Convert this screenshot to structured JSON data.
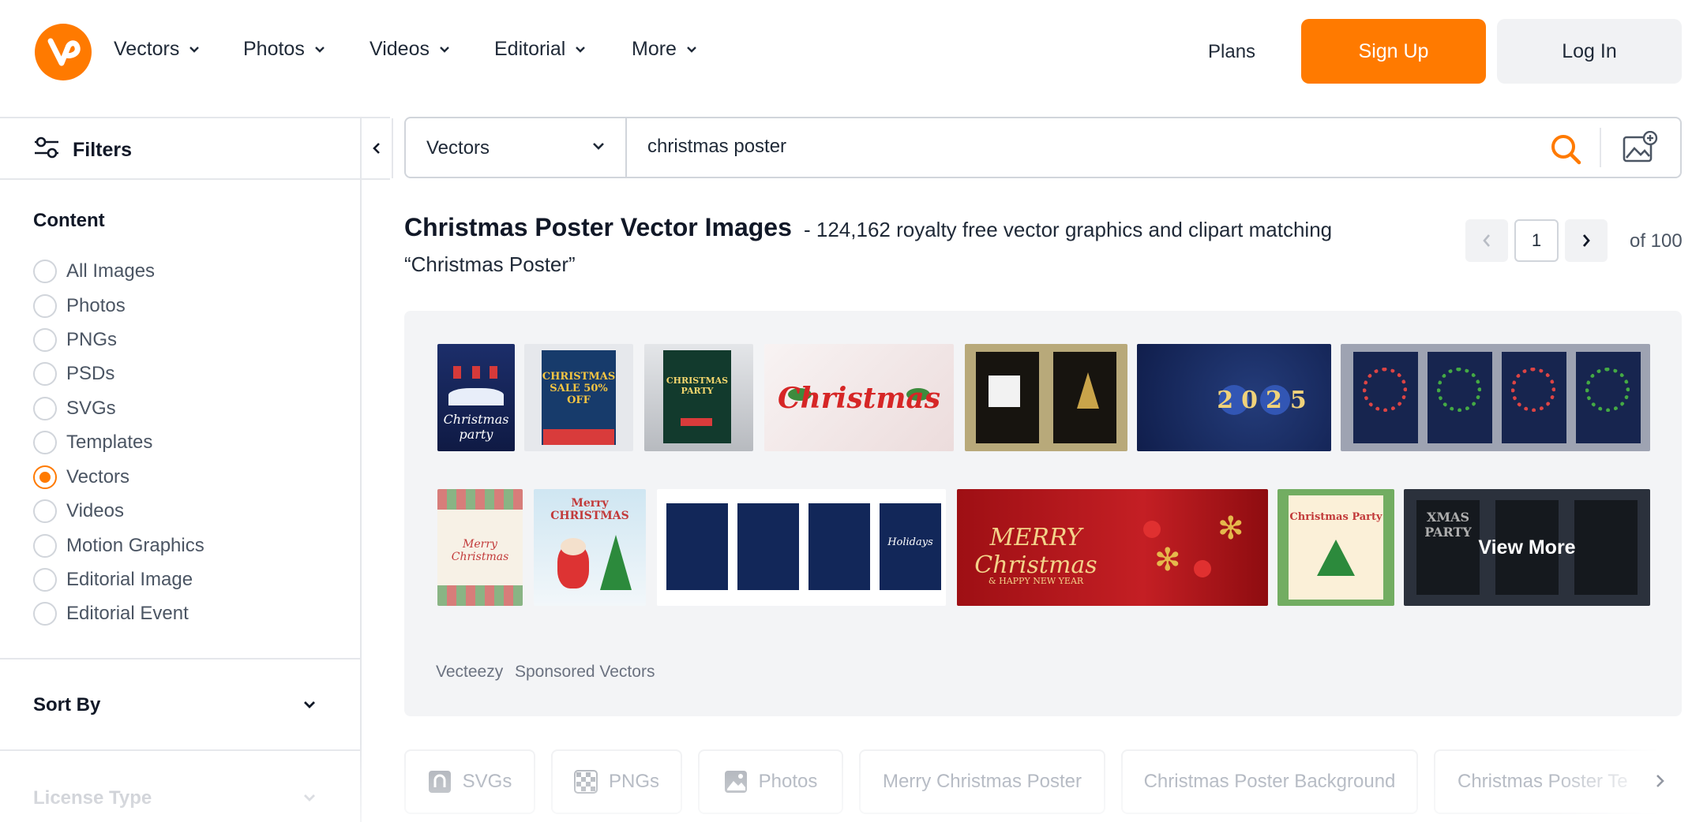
{
  "header": {
    "logo_icon": "vecteezy-logo-icon",
    "nav": [
      {
        "label": "Vectors"
      },
      {
        "label": "Photos"
      },
      {
        "label": "Videos"
      },
      {
        "label": "Editorial"
      },
      {
        "label": "More"
      }
    ],
    "plans_label": "Plans",
    "signup_label": "Sign Up",
    "login_label": "Log In"
  },
  "sidebar": {
    "filters_label": "Filters",
    "content_title": "Content",
    "content_options": [
      {
        "label": "All Images",
        "checked": false
      },
      {
        "label": "Photos",
        "checked": false
      },
      {
        "label": "PNGs",
        "checked": false
      },
      {
        "label": "PSDs",
        "checked": false
      },
      {
        "label": "SVGs",
        "checked": false
      },
      {
        "label": "Templates",
        "checked": false
      },
      {
        "label": "Vectors",
        "checked": true
      },
      {
        "label": "Videos",
        "checked": false
      },
      {
        "label": "Motion Graphics",
        "checked": false
      },
      {
        "label": "Editorial Image",
        "checked": false
      },
      {
        "label": "Editorial Event",
        "checked": false
      }
    ],
    "sort_by_label": "Sort By",
    "license_type_label": "License Type"
  },
  "search": {
    "type_label": "Vectors",
    "query": "christmas poster"
  },
  "results": {
    "title": "Christmas Poster Vector Images",
    "subtitle": "- 124,162 royalty free vector graphics and clipart matching",
    "subtitle_query": "“Christmas Poster”",
    "page_current": "1",
    "page_of": "of 100"
  },
  "sponsored": {
    "brand": "Vecteezy",
    "label": "Sponsored Vectors",
    "view_more_label": "View More",
    "thumb_texts": {
      "party": "Christmas party",
      "sale": "CHRISTMAS SALE 50% OFF",
      "party2": "CHRISTMAS PARTY",
      "christmas": "Christmas",
      "year": "2025",
      "merry": "Merry Christmas",
      "merry2": "Merry CHRISTMAS",
      "merry_big": "MERRY Christmas",
      "happy_new_year": "& HAPPY NEW YEAR",
      "xmas": "XMAS PARTY",
      "party3": "Christmas Party",
      "holidays": "Holidays"
    }
  },
  "related": {
    "chips": [
      {
        "label": "SVGs",
        "icon": "svg-file-icon"
      },
      {
        "label": "PNGs",
        "icon": "png-checker-icon"
      },
      {
        "label": "Photos",
        "icon": "photo-icon"
      },
      {
        "label": "Merry Christmas Poster"
      },
      {
        "label": "Christmas Poster Background"
      },
      {
        "label": "Christmas Poster Te"
      }
    ]
  },
  "colors": {
    "accent": "#ff7a00",
    "text": "#1f2937",
    "muted": "#6b7280",
    "panel": "#f3f4f6"
  }
}
